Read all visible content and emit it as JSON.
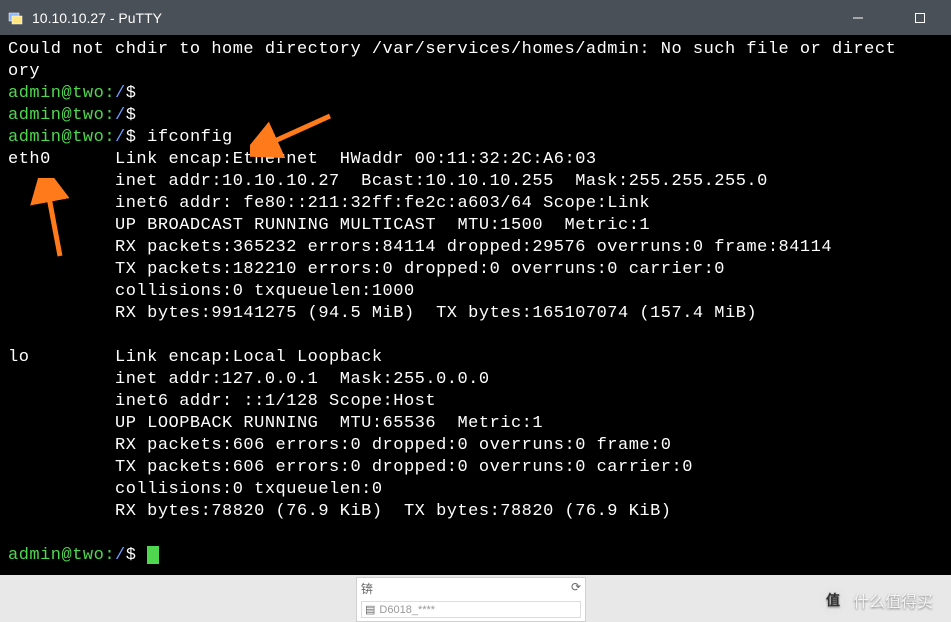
{
  "window": {
    "title": "10.10.10.27 - PuTTY",
    "app_name": "PuTTY"
  },
  "terminal": {
    "error_line": "Could not chdir to home directory /var/services/homes/admin: No such file or directory",
    "prompt": {
      "user_host": "admin@two",
      "path": "/",
      "symbol": "$"
    },
    "command": "ifconfig",
    "interfaces": [
      {
        "name": "eth0",
        "lines": [
          "Link encap:Ethernet  HWaddr 00:11:32:2C:A6:03",
          "inet addr:10.10.10.27  Bcast:10.10.10.255  Mask:255.255.255.0",
          "inet6 addr: fe80::211:32ff:fe2c:a603/64 Scope:Link",
          "UP BROADCAST RUNNING MULTICAST  MTU:1500  Metric:1",
          "RX packets:365232 errors:84114 dropped:29576 overruns:0 frame:84114",
          "TX packets:182210 errors:0 dropped:0 overruns:0 carrier:0",
          "collisions:0 txqueuelen:1000",
          "RX bytes:99141275 (94.5 MiB)  TX bytes:165107074 (157.4 MiB)"
        ]
      },
      {
        "name": "lo",
        "lines": [
          "Link encap:Local Loopback",
          "inet addr:127.0.0.1  Mask:255.0.0.0",
          "inet6 addr: ::1/128 Scope:Host",
          "UP LOOPBACK RUNNING  MTU:65536  Metric:1",
          "RX packets:606 errors:0 dropped:0 overruns:0 frame:0",
          "TX packets:606 errors:0 dropped:0 overruns:0 carrier:0",
          "collisions:0 txqueuelen:0",
          "RX bytes:78820 (76.9 KiB)  TX bytes:78820 (76.9 KiB)"
        ]
      }
    ]
  },
  "annotations": {
    "arrow1_color": "#ff7a1a",
    "arrow2_color": "#ff7a1a"
  },
  "watermark": {
    "badge": "值",
    "text": "什么值得买"
  },
  "bg_fragment": {
    "char": "锛",
    "file_icon": "▤"
  }
}
